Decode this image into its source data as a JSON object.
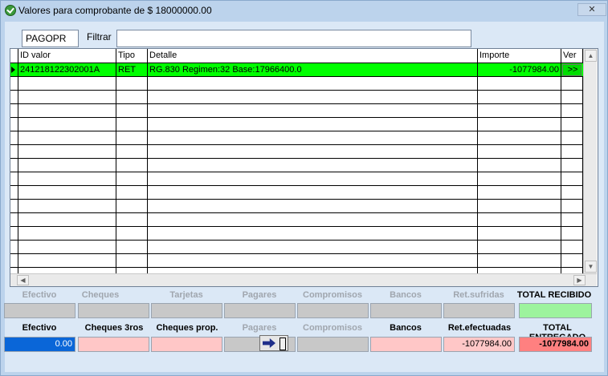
{
  "window": {
    "title": "Valores para comprobante de $ 18000000.00",
    "close_label": "✕"
  },
  "filter": {
    "code": "PAGOPR",
    "label": "Filtrar",
    "value": ""
  },
  "grid": {
    "columns": [
      "ID valor",
      "Tipo",
      "Detalle",
      "Importe",
      "Ver"
    ],
    "rows": [
      {
        "id": "241218122302001A",
        "tipo": "RET",
        "detalle": "RG.830 Regimen:32 Base:17966400.0",
        "importe": "-1077984.00",
        "ver": ">>"
      }
    ]
  },
  "recibido": {
    "labels": [
      "Efectivo",
      "Cheques",
      "Tarjetas",
      "Pagares",
      "Compromisos",
      "Bancos",
      "Ret.sufridas",
      "TOTAL RECIBIDO"
    ],
    "values": [
      "",
      "",
      "",
      "",
      "",
      "",
      "",
      ""
    ]
  },
  "entregado": {
    "labels": [
      "Efectivo",
      "Cheques 3ros",
      "Cheques prop.",
      "Pagares",
      "Compromisos",
      "Bancos",
      "Ret.efectuadas",
      "TOTAL ENTREGADO"
    ],
    "values": [
      "0.00",
      "",
      "",
      "",
      "",
      "",
      "-1077984.00",
      "-1077984.00"
    ]
  },
  "icons": {
    "confirm": "exit-door-arrow-icon",
    "app": "check-circle-icon"
  }
}
